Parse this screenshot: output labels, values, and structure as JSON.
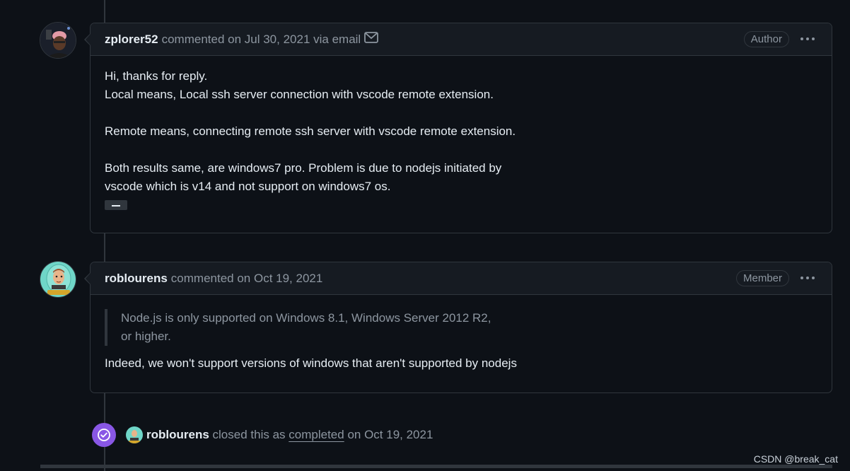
{
  "comments": [
    {
      "author": "zplorer52",
      "action": "commented on Jul 30, 2021 via email",
      "via_icon": "mail-icon",
      "role_badge": "Author",
      "menu_icon": "kebab-horizontal-icon",
      "body": [
        "Hi, thanks for reply.",
        "Local means, Local ssh server connection with vscode remote extension.",
        "",
        "Remote means, connecting remote ssh server with vscode remote extension.",
        "",
        "Both results same, are windows7 pro. Problem is due to nodejs initiated by",
        "vscode which is v14 and not support on windows7 os."
      ],
      "expand_button": "..."
    },
    {
      "author": "roblourens",
      "action": "commented on Oct 19, 2021",
      "role_badge": "Member",
      "menu_icon": "kebab-horizontal-icon",
      "quote": [
        "Node.js is only supported on Windows 8.1, Windows Server 2012 R2,",
        "or higher."
      ],
      "body": "Indeed, we won't support versions of windows that aren't supported by nodejs"
    }
  ],
  "event": {
    "icon": "check-circle-icon",
    "author": "roblourens",
    "text_before": "closed this as",
    "link": "completed",
    "text_after": "on Oct 19, 2021",
    "color": "#8957e5"
  },
  "watermark": "CSDN @break_cat",
  "colors": {
    "background": "#0d1117",
    "header": "#161b22",
    "border": "#30363d",
    "muted": "#8d96a0",
    "closed_purple": "#8957e5"
  }
}
